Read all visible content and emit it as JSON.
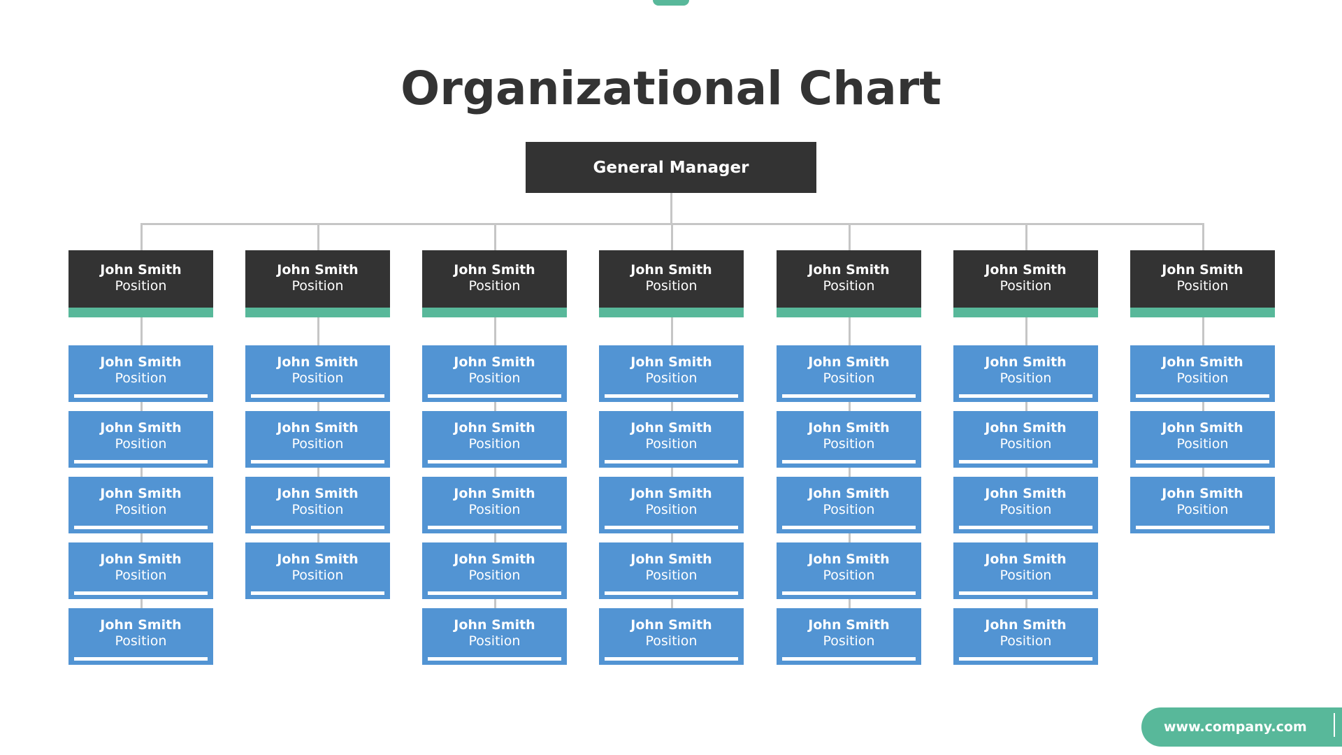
{
  "title": "Organizational Chart",
  "colors": {
    "dark": "#333333",
    "accent_green": "#58b89a",
    "node_blue": "#5294d3",
    "connector": "#c6c6c6"
  },
  "root": {
    "label": "General Manager"
  },
  "departments": [
    {
      "head": {
        "name": "John Smith",
        "position": "Position"
      },
      "members": [
        {
          "name": "John Smith",
          "position": "Position"
        },
        {
          "name": "John Smith",
          "position": "Position"
        },
        {
          "name": "John Smith",
          "position": "Position"
        },
        {
          "name": "John Smith",
          "position": "Position"
        },
        {
          "name": "John Smith",
          "position": "Position"
        }
      ]
    },
    {
      "head": {
        "name": "John Smith",
        "position": "Position"
      },
      "members": [
        {
          "name": "John Smith",
          "position": "Position"
        },
        {
          "name": "John Smith",
          "position": "Position"
        },
        {
          "name": "John Smith",
          "position": "Position"
        },
        {
          "name": "John Smith",
          "position": "Position"
        }
      ]
    },
    {
      "head": {
        "name": "John Smith",
        "position": "Position"
      },
      "members": [
        {
          "name": "John Smith",
          "position": "Position"
        },
        {
          "name": "John Smith",
          "position": "Position"
        },
        {
          "name": "John Smith",
          "position": "Position"
        },
        {
          "name": "John Smith",
          "position": "Position"
        },
        {
          "name": "John Smith",
          "position": "Position"
        }
      ]
    },
    {
      "head": {
        "name": "John Smith",
        "position": "Position"
      },
      "members": [
        {
          "name": "John Smith",
          "position": "Position"
        },
        {
          "name": "John Smith",
          "position": "Position"
        },
        {
          "name": "John Smith",
          "position": "Position"
        },
        {
          "name": "John Smith",
          "position": "Position"
        },
        {
          "name": "John Smith",
          "position": "Position"
        }
      ]
    },
    {
      "head": {
        "name": "John Smith",
        "position": "Position"
      },
      "members": [
        {
          "name": "John Smith",
          "position": "Position"
        },
        {
          "name": "John Smith",
          "position": "Position"
        },
        {
          "name": "John Smith",
          "position": "Position"
        },
        {
          "name": "John Smith",
          "position": "Position"
        },
        {
          "name": "John Smith",
          "position": "Position"
        }
      ]
    },
    {
      "head": {
        "name": "John Smith",
        "position": "Position"
      },
      "members": [
        {
          "name": "John Smith",
          "position": "Position"
        },
        {
          "name": "John Smith",
          "position": "Position"
        },
        {
          "name": "John Smith",
          "position": "Position"
        },
        {
          "name": "John Smith",
          "position": "Position"
        },
        {
          "name": "John Smith",
          "position": "Position"
        }
      ]
    },
    {
      "head": {
        "name": "John Smith",
        "position": "Position"
      },
      "members": [
        {
          "name": "John Smith",
          "position": "Position"
        },
        {
          "name": "John Smith",
          "position": "Position"
        },
        {
          "name": "John Smith",
          "position": "Position"
        }
      ]
    }
  ],
  "footer": {
    "url": "www.company.com"
  }
}
